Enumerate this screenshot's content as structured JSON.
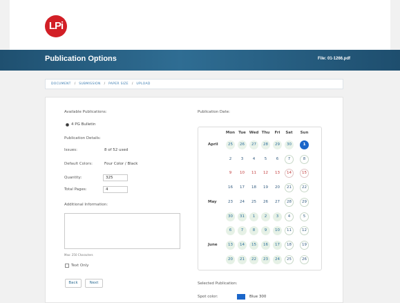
{
  "logo": {
    "text": "LPi"
  },
  "banner": {
    "title": "Publication Options",
    "file": "File: 01-1266.pdf"
  },
  "breadcrumb": [
    "DOCUMENT",
    "SUBMISSION",
    "PAPER SIZE",
    "UPLOAD"
  ],
  "form": {
    "available_label": "Available Publications:",
    "publication_option": "4 PG Bulletin",
    "details_label": "Publication Details:",
    "issues_label": "Issues:",
    "issues_value": "8 of 52 used",
    "default_colors_label": "Default Colors:",
    "default_colors_value": "Four Color / Black",
    "quantity_label": "Quantity:",
    "quantity_value": "325",
    "total_pages_label": "Total Pages:",
    "total_pages_value": "4",
    "additional_info_label": "Additional Information:",
    "max_chars": "Max: 250 Characters",
    "text_only_label": "Text Only",
    "back_label": "Back",
    "next_label": "Next"
  },
  "dates_label": "Publication Date:",
  "calendar": {
    "headers": [
      "Mon",
      "Tue",
      "Wed",
      "Thu",
      "Fri",
      "Sat",
      "Sun"
    ],
    "months": [
      "April",
      "May",
      "June"
    ],
    "rows": [
      [
        "25",
        "26",
        "27",
        "28",
        "29",
        "30",
        "1"
      ],
      [
        "2",
        "3",
        "4",
        "5",
        "6",
        "7",
        "8"
      ],
      [
        "9",
        "10",
        "11",
        "12",
        "13",
        "14",
        "15"
      ],
      [
        "16",
        "17",
        "18",
        "19",
        "20",
        "21",
        "22"
      ],
      [
        "23",
        "24",
        "25",
        "26",
        "27",
        "28",
        "29"
      ],
      [
        "30",
        "31",
        "1",
        "2",
        "3",
        "4",
        "5"
      ],
      [
        "6",
        "7",
        "8",
        "9",
        "10",
        "11",
        "12"
      ],
      [
        "13",
        "14",
        "15",
        "16",
        "17",
        "18",
        "19"
      ],
      [
        "20",
        "21",
        "22",
        "23",
        "24",
        "25",
        "26"
      ]
    ]
  },
  "selected": {
    "label": "Selected Publication:",
    "spot_color_label": "Spot color:",
    "spot_color_value": "Blue 300",
    "spot_color_hex": "#1b66c9"
  }
}
